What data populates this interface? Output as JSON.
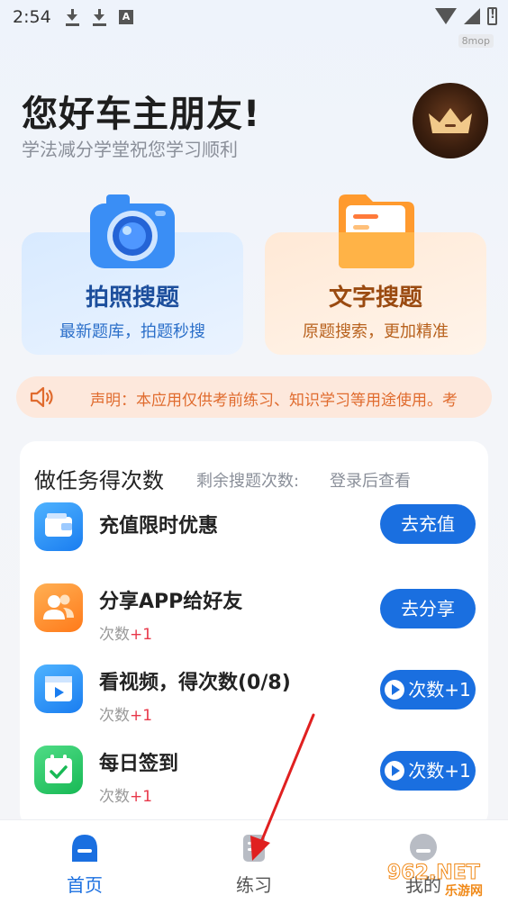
{
  "status_bar": {
    "time": "2:54",
    "watermark": "8mop"
  },
  "header": {
    "greeting": "您好车主朋友!",
    "subtitle": "学法减分学堂祝您学习顺利"
  },
  "search_cards": [
    {
      "title": "拍照搜题",
      "desc": "最新题库，拍题秒搜",
      "icon": "camera-icon"
    },
    {
      "title": "文字搜题",
      "desc": "原题搜索，更加精准",
      "icon": "folder-icon"
    }
  ],
  "notice": {
    "icon": "speaker-icon",
    "text": "声明：本应用仅供考前练习、知识学习等用途使用。考"
  },
  "tasks_panel": {
    "title": "做任务得次数",
    "remain_label": "剩余搜题次数:",
    "remain_value": "登录后查看",
    "items": [
      {
        "name": "充值限时优惠",
        "sub_label": "",
        "sub_plus": "",
        "button": "去充值",
        "icon": "wallet-icon"
      },
      {
        "name": "分享APP给好友",
        "sub_label": "次数",
        "sub_plus": "+1",
        "button": "去分享",
        "icon": "users-icon"
      },
      {
        "name": "看视频，得次数(0/8)",
        "sub_label": "次数",
        "sub_plus": "+1",
        "button": "次数+1",
        "icon": "video-icon"
      },
      {
        "name": "每日签到",
        "sub_label": "次数",
        "sub_plus": "+1",
        "button": "次数+1",
        "icon": "calendar-check-icon"
      }
    ]
  },
  "tabbar": {
    "tabs": [
      {
        "label": "首页",
        "icon": "home-icon",
        "active": true
      },
      {
        "label": "练习",
        "icon": "practice-icon",
        "active": false
      },
      {
        "label": "我的",
        "icon": "profile-icon",
        "active": false
      }
    ]
  },
  "overlay": {
    "site_watermark": "962.NET",
    "site_watermark_sub": "乐游网"
  },
  "colors": {
    "primary": "#1a6fe0",
    "notice_text": "#e06b2e",
    "plus_red": "#e8384a"
  }
}
